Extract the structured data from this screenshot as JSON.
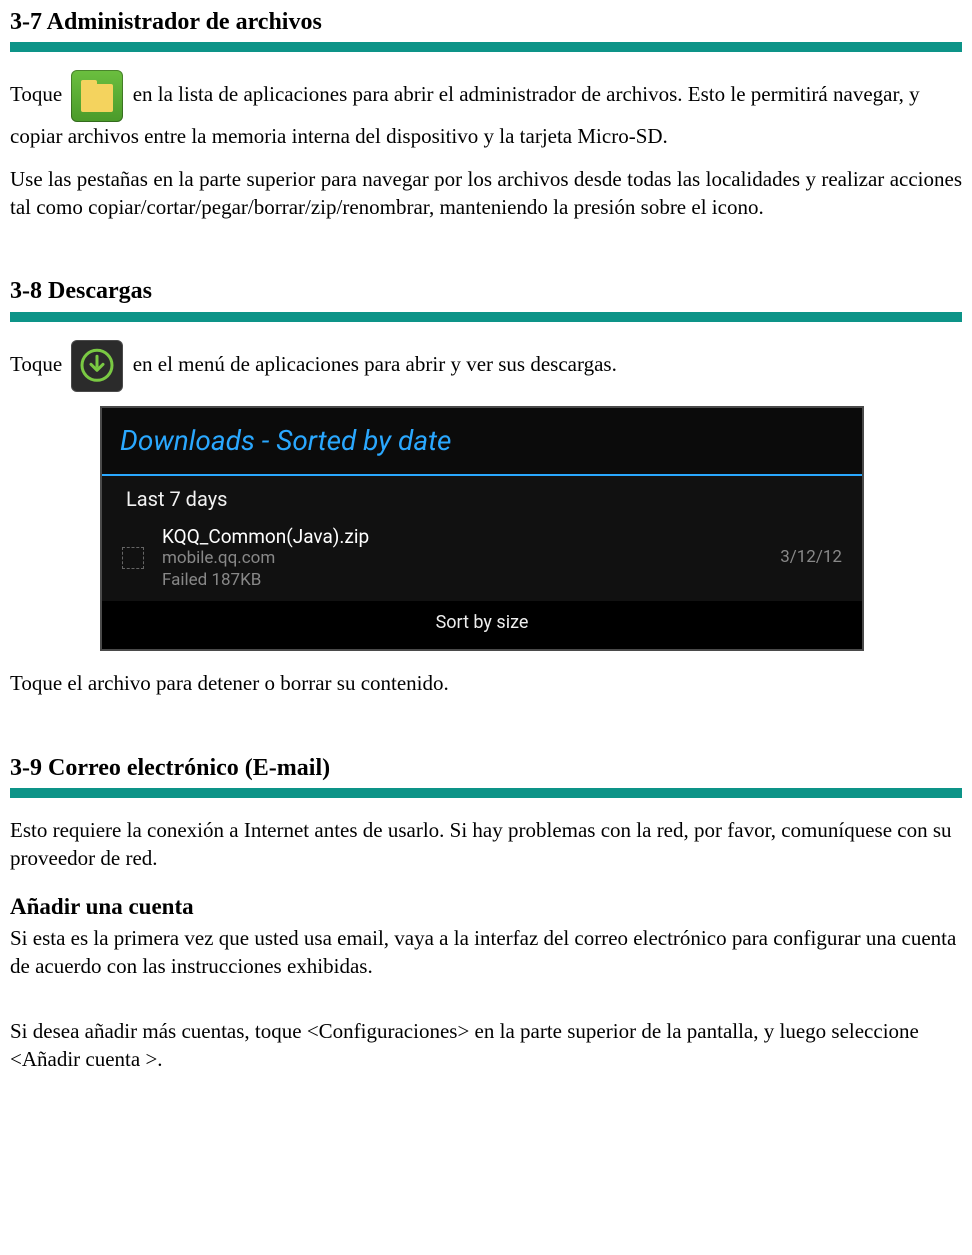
{
  "s37": {
    "title": "3-7 Administrador de archivos",
    "p1a": "Toque ",
    "p1b": " en la lista de aplicaciones para abrir el administrador de archivos. Esto le permitirá navegar, y copiar archivos entre la memoria interna del dispositivo y la tarjeta Micro-SD.",
    "p2": "Use las pestañas en la parte superior para navegar por los archivos desde todas las localidades y realizar acciones tal como copiar/cortar/pegar/borrar/zip/renombrar, manteniendo la presión sobre el icono."
  },
  "s38": {
    "title": "3-8 Descargas",
    "p1a": "Toque ",
    "p1b": " en el menú de aplicaciones para abrir y ver sus descargas.",
    "shot": {
      "header": "Downloads - Sorted by date",
      "group": "Last 7 days",
      "item_title": "KQQ_Common(Java).zip",
      "item_host": "mobile.qq.com",
      "item_status": "Failed   187KB",
      "item_date": "3/12/12",
      "footer": "Sort by size"
    },
    "p2": "Toque el archivo para detener o borrar su contenido."
  },
  "s39": {
    "title": "3-9 Correo electrónico (E-mail)",
    "p1": "Esto requiere la conexión a Internet antes de usarlo. Si hay problemas con la red, por favor, comuníquese con su proveedor de red.",
    "sub": "Añadir una cuenta",
    "p2": "Si esta es la primera vez que usted usa email, vaya a la interfaz del correo electrónico para configurar una cuenta de acuerdo con las instrucciones exhibidas.",
    "p3": "Si desea añadir más cuentas, toque <Configuraciones> en la parte superior de la pantalla, y luego seleccione <Añadir cuenta >."
  }
}
